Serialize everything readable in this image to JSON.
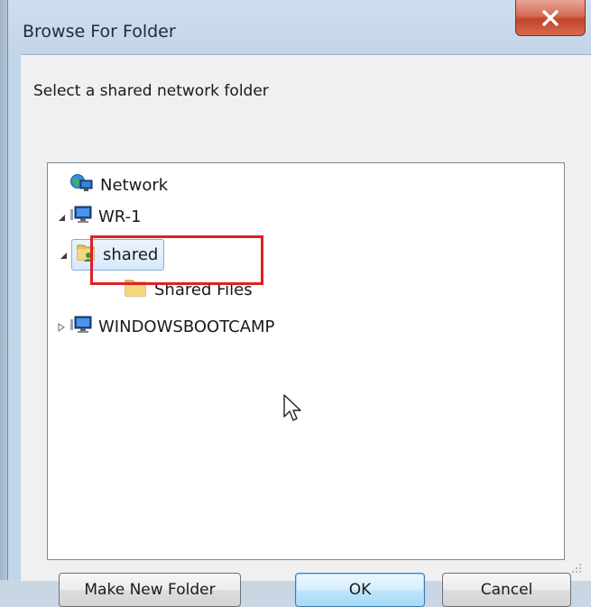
{
  "window": {
    "title": "Browse For Folder",
    "close_label": "X"
  },
  "prompt": "Select a shared network folder",
  "tree": {
    "items": [
      {
        "label": "Network",
        "icon": "network-globe-icon",
        "expander": "none"
      },
      {
        "label": "WR-1",
        "icon": "computer-icon",
        "expander": "expanded"
      },
      {
        "label": "shared",
        "icon": "shared-folder-icon",
        "expander": "expanded",
        "selected": true
      },
      {
        "label": "Shared Files",
        "icon": "folder-icon",
        "expander": "none"
      },
      {
        "label": "WINDOWSBOOTCAMP",
        "icon": "computer-icon",
        "expander": "collapsed"
      }
    ]
  },
  "buttons": {
    "make_new_folder": "Make New Folder",
    "ok": "OK",
    "cancel": "Cancel"
  },
  "colors": {
    "highlight": "#e01f26",
    "selection": "#d9e9fa",
    "close": "#c2432b"
  }
}
